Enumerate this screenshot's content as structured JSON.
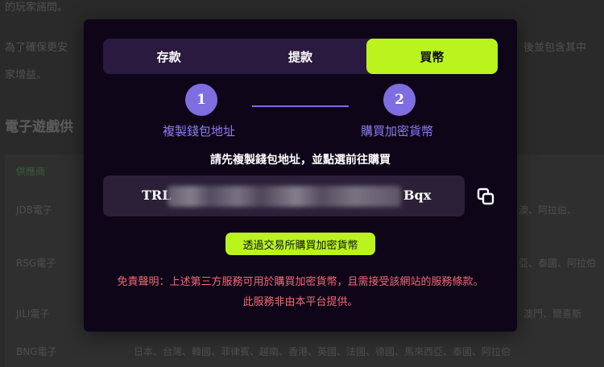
{
  "background": {
    "lines": [
      "的玩家諮問。",
      "為了確保更安",
      "家增益。",
      "後並包含其中"
    ],
    "section_title": "電子遊戲供",
    "table_header": "供應商",
    "rows": [
      "JDB電子",
      "RSG電子",
      "JILI電子",
      "BNG電子"
    ],
    "right_text": [
      "澳、阿拉伯、",
      "亞、泰國、阿拉伯",
      "澳門、爾喜斯",
      "日本、台灣、韓國、菲律賓、越南、香港、英國、法國、德國、馬來西亞、泰國、阿拉伯"
    ]
  },
  "modal": {
    "tabs": [
      {
        "label": "存款",
        "active": false
      },
      {
        "label": "提款",
        "active": false
      },
      {
        "label": "買幣",
        "active": true
      }
    ],
    "steps": [
      {
        "number": "1",
        "label": "複製錢包地址"
      },
      {
        "number": "2",
        "label": "購買加密貨幣"
      }
    ],
    "instruction": "請先複製錢包地址，並點選前往購買",
    "address": {
      "prefix": "TRL",
      "suffix": "Bqx"
    },
    "buy_button": "透過交易所購買加密貨幣",
    "disclaimer_line1": "免責聲明：上述第三方服務可用於購買加密貨幣，且需接受該網站的服務條款。",
    "disclaimer_line2": "此服務非由本平台提供。"
  },
  "colors": {
    "accent": "#baf41c",
    "step": "#7e6ee0",
    "warning": "#f26a78"
  }
}
